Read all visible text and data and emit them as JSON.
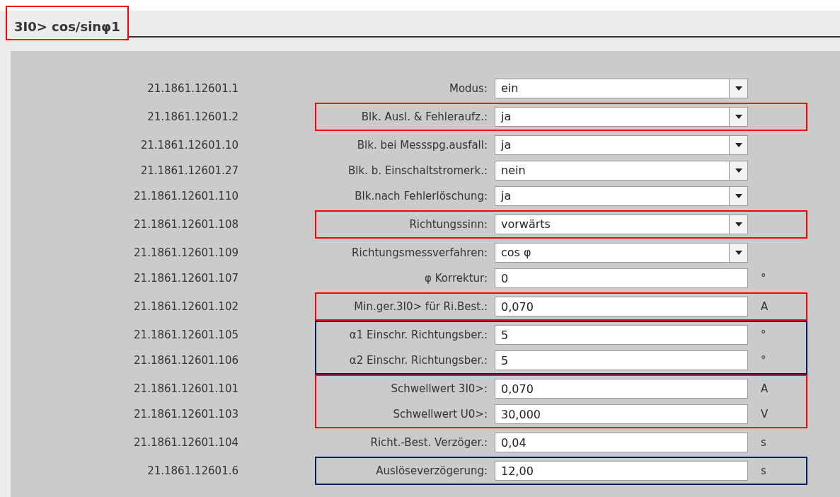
{
  "title": {
    "text": "3I0> cos/sinφ1",
    "color": "#ff0000"
  },
  "groups": [
    {
      "rows": [
        {
          "id": "21.1861.12601.1",
          "label": "Modus:",
          "kind": "dropdown",
          "value": "ein"
        }
      ]
    },
    {
      "color": "#ff0000",
      "rows": [
        {
          "id": "21.1861.12601.2",
          "label": "Blk. Ausl. & Fehleraufz.:",
          "kind": "dropdown",
          "value": "ja"
        }
      ]
    },
    {
      "rows": [
        {
          "id": "21.1861.12601.10",
          "label": "Blk. bei Messspg.ausfall:",
          "kind": "dropdown",
          "value": "ja"
        },
        {
          "id": "21.1861.12601.27",
          "label": "Blk. b. Einschaltstromerk.:",
          "kind": "dropdown",
          "value": "nein"
        },
        {
          "id": "21.1861.12601.110",
          "label": "Blk.nach Fehlerlöschung:",
          "kind": "dropdown",
          "value": "ja"
        }
      ]
    },
    {
      "color": "#ff0000",
      "rows": [
        {
          "id": "21.1861.12601.108",
          "label": "Richtungssinn:",
          "kind": "dropdown",
          "value": "vorwärts"
        }
      ]
    },
    {
      "rows": [
        {
          "id": "21.1861.12601.109",
          "label": "Richtungsmessverfahren:",
          "kind": "dropdown",
          "value": "cos φ"
        },
        {
          "id": "21.1861.12601.107",
          "label": "φ Korrektur:",
          "kind": "input",
          "value": "0",
          "unit": "°"
        }
      ]
    },
    {
      "color": "#ff0000",
      "rows": [
        {
          "id": "21.1861.12601.102",
          "label": "Min.ger.3I0> für Ri.Best.:",
          "kind": "input",
          "value": "0,070",
          "unit": "A"
        }
      ]
    },
    {
      "color": "#0a1f5c",
      "rows": [
        {
          "id": "21.1861.12601.105",
          "label": "α1 Einschr. Richtungsber.:",
          "kind": "input",
          "value": "5",
          "unit": "°"
        },
        {
          "id": "21.1861.12601.106",
          "label": "α2 Einschr. Richtungsber.:",
          "kind": "input",
          "value": "5",
          "unit": "°"
        }
      ]
    },
    {
      "color": "#ff0000",
      "rows": [
        {
          "id": "21.1861.12601.101",
          "label": "Schwellwert 3I0>:",
          "kind": "input",
          "value": "0,070",
          "unit": "A"
        },
        {
          "id": "21.1861.12601.103",
          "label": "Schwellwert U0>:",
          "kind": "input",
          "value": "30,000",
          "unit": "V"
        }
      ]
    },
    {
      "rows": [
        {
          "id": "21.1861.12601.104",
          "label": "Richt.-Best. Verzöger.:",
          "kind": "input",
          "value": "0,04",
          "unit": "s"
        }
      ]
    },
    {
      "color": "#0a1f5c",
      "rows": [
        {
          "id": "21.1861.12601.6",
          "label": "Auslöseverzögerung:",
          "kind": "input",
          "value": "12,00",
          "unit": "s"
        }
      ]
    }
  ]
}
